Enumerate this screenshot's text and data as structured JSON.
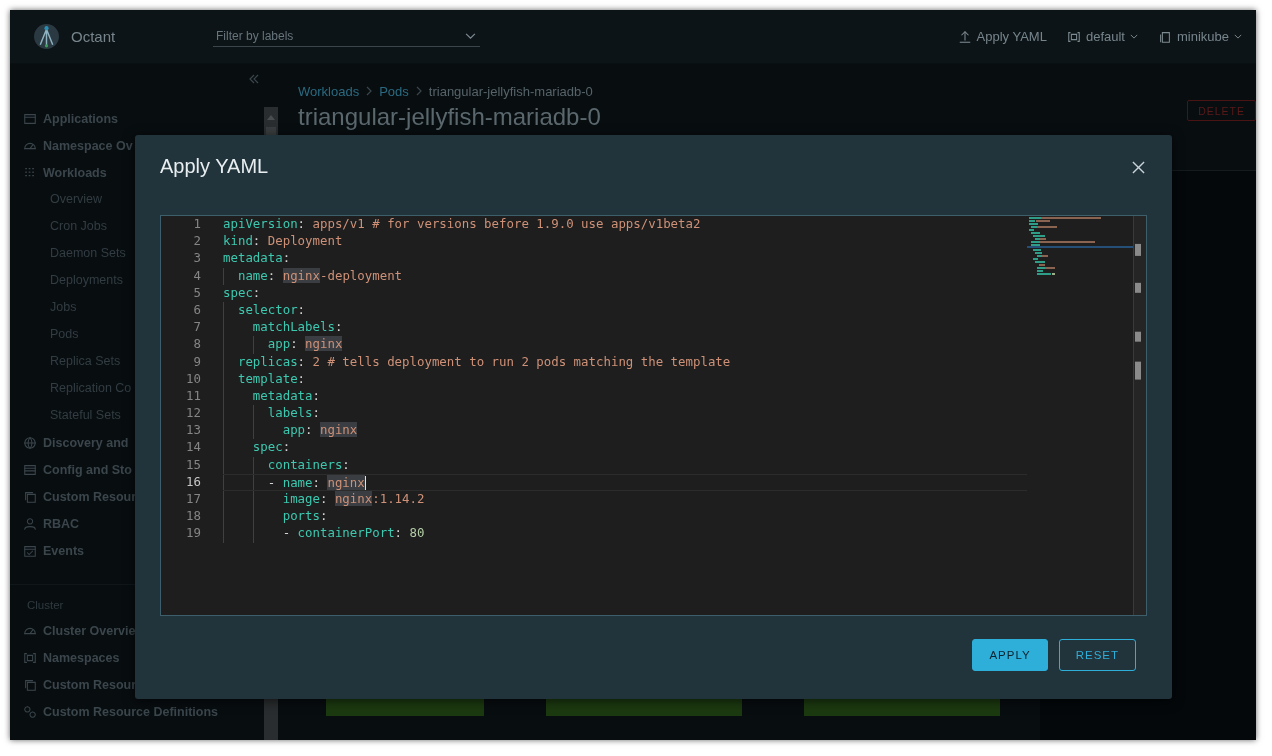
{
  "app": {
    "name": "Octant"
  },
  "filter": {
    "placeholder": "Filter by labels"
  },
  "topbar_actions": [
    {
      "label": "Apply YAML",
      "kind": "button"
    },
    {
      "label": "default",
      "kind": "dropdown"
    },
    {
      "label": "minikube",
      "kind": "dropdown"
    }
  ],
  "sidebar": {
    "sections": [
      {
        "items": [
          {
            "label": "Applications"
          },
          {
            "label": "Namespace Ov"
          },
          {
            "label": "Workloads",
            "children": [
              {
                "label": "Overview"
              },
              {
                "label": "Cron Jobs"
              },
              {
                "label": "Daemon Sets"
              },
              {
                "label": "Deployments"
              },
              {
                "label": "Jobs"
              },
              {
                "label": "Pods"
              },
              {
                "label": "Replica Sets"
              },
              {
                "label": "Replication Co"
              },
              {
                "label": "Stateful Sets"
              }
            ]
          },
          {
            "label": "Discovery and"
          },
          {
            "label": "Config and Sto"
          },
          {
            "label": "Custom Resour"
          },
          {
            "label": "RBAC"
          },
          {
            "label": "Events"
          }
        ]
      },
      {
        "header": "Cluster",
        "items": [
          {
            "label": "Cluster Overvie"
          },
          {
            "label": "Namespaces"
          },
          {
            "label": "Custom Resour"
          },
          {
            "label": "Custom Resource Definitions"
          }
        ]
      }
    ]
  },
  "breadcrumb": [
    {
      "label": "Workloads",
      "link": true
    },
    {
      "label": "Pods",
      "link": true
    },
    {
      "label": "triangular-jellyfish-mariadb-0",
      "link": false
    }
  ],
  "page_title": "triangular-jellyfish-mariadb-0",
  "delete_button": "DELETE",
  "modal": {
    "title": "Apply YAML",
    "editor": {
      "lines": [
        {
          "number": "1",
          "current": false,
          "tokens": [
            {
              "kind": "key",
              "text": "apiVersion"
            },
            {
              "kind": "punct",
              "text": ": "
            },
            {
              "kind": "value",
              "text": "apps/v1 # for versions before 1.9.0 use apps/v1beta2"
            }
          ]
        },
        {
          "number": "2",
          "current": false,
          "tokens": [
            {
              "kind": "key",
              "text": "kind"
            },
            {
              "kind": "punct",
              "text": ": "
            },
            {
              "kind": "value",
              "text": "Deployment"
            }
          ]
        },
        {
          "number": "3",
          "current": false,
          "tokens": [
            {
              "kind": "key",
              "text": "metadata"
            },
            {
              "kind": "punct",
              "text": ":"
            }
          ]
        },
        {
          "number": "4",
          "current": false,
          "tokens": [
            {
              "kind": "key",
              "text": "  name"
            },
            {
              "kind": "punct",
              "text": ": "
            },
            {
              "kind": "match",
              "text": "nginx"
            },
            {
              "kind": "value",
              "text": "-deployment"
            }
          ]
        },
        {
          "number": "5",
          "current": false,
          "tokens": [
            {
              "kind": "key",
              "text": "spec"
            },
            {
              "kind": "punct",
              "text": ":"
            }
          ]
        },
        {
          "number": "6",
          "current": false,
          "tokens": [
            {
              "kind": "key",
              "text": "  selector"
            },
            {
              "kind": "punct",
              "text": ":"
            }
          ]
        },
        {
          "number": "7",
          "current": false,
          "tokens": [
            {
              "kind": "key",
              "text": "    matchLabels"
            },
            {
              "kind": "punct",
              "text": ":"
            }
          ]
        },
        {
          "number": "8",
          "current": false,
          "tokens": [
            {
              "kind": "key",
              "text": "      app"
            },
            {
              "kind": "punct",
              "text": ": "
            },
            {
              "kind": "match",
              "text": "nginx"
            }
          ]
        },
        {
          "number": "9",
          "current": false,
          "tokens": [
            {
              "kind": "key",
              "text": "  replicas"
            },
            {
              "kind": "punct",
              "text": ": "
            },
            {
              "kind": "value",
              "text": "2 # tells deployment to run 2 pods matching the template"
            }
          ]
        },
        {
          "number": "10",
          "current": false,
          "tokens": [
            {
              "kind": "key",
              "text": "  template"
            },
            {
              "kind": "punct",
              "text": ":"
            }
          ]
        },
        {
          "number": "11",
          "current": false,
          "tokens": [
            {
              "kind": "key",
              "text": "    metadata"
            },
            {
              "kind": "punct",
              "text": ":"
            }
          ]
        },
        {
          "number": "12",
          "current": false,
          "tokens": [
            {
              "kind": "key",
              "text": "      labels"
            },
            {
              "kind": "punct",
              "text": ":"
            }
          ]
        },
        {
          "number": "13",
          "current": false,
          "tokens": [
            {
              "kind": "key",
              "text": "        app"
            },
            {
              "kind": "punct",
              "text": ": "
            },
            {
              "kind": "match",
              "text": "nginx"
            }
          ]
        },
        {
          "number": "14",
          "current": false,
          "tokens": [
            {
              "kind": "key",
              "text": "    spec"
            },
            {
              "kind": "punct",
              "text": ":"
            }
          ]
        },
        {
          "number": "15",
          "current": false,
          "tokens": [
            {
              "kind": "key",
              "text": "      containers"
            },
            {
              "kind": "punct",
              "text": ":"
            }
          ]
        },
        {
          "number": "16",
          "current": true,
          "tokens": [
            {
              "kind": "punct",
              "text": "      - "
            },
            {
              "kind": "key",
              "text": "name"
            },
            {
              "kind": "punct",
              "text": ": "
            },
            {
              "kind": "match",
              "text": "nginx"
            }
          ]
        },
        {
          "number": "17",
          "current": false,
          "tokens": [
            {
              "kind": "key",
              "text": "        image"
            },
            {
              "kind": "punct",
              "text": ": "
            },
            {
              "kind": "match",
              "text": "nginx"
            },
            {
              "kind": "value",
              "text": ":1.14.2"
            }
          ]
        },
        {
          "number": "18",
          "current": false,
          "tokens": [
            {
              "kind": "key",
              "text": "        ports"
            },
            {
              "kind": "punct",
              "text": ":"
            }
          ]
        },
        {
          "number": "19",
          "current": false,
          "tokens": [
            {
              "kind": "punct",
              "text": "        - "
            },
            {
              "kind": "key",
              "text": "containerPort"
            },
            {
              "kind": "punct",
              "text": ": "
            },
            {
              "kind": "number",
              "text": "80"
            }
          ]
        }
      ]
    },
    "buttons": [
      {
        "label": "APPLY",
        "kind": "primary"
      },
      {
        "label": "RESET",
        "kind": "outline"
      }
    ]
  }
}
